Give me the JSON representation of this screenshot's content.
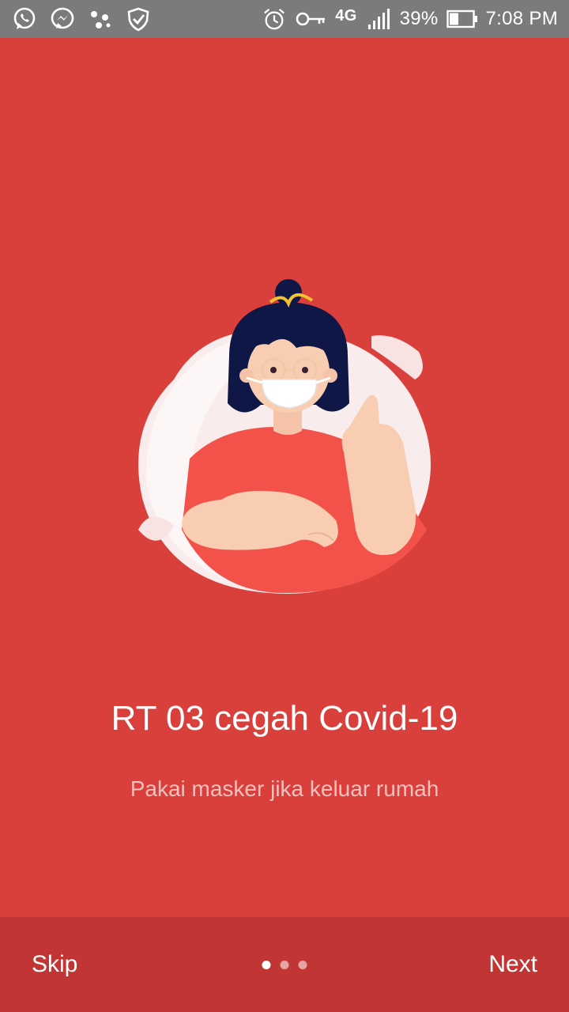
{
  "status_bar": {
    "left_icons": [
      "whatsapp-icon",
      "messenger-icon",
      "app-dots-icon",
      "shield-check-icon"
    ],
    "right_icons": [
      "alarm-icon",
      "key-icon",
      "signal-icon",
      "battery-icon"
    ],
    "network": "4G",
    "battery_percent": "39%",
    "battery_level": 0.39,
    "time": "7:08 PM"
  },
  "onboarding": {
    "illustration": "woman-wearing-mask-thumbs-up",
    "title": "RT 03 cegah Covid-19",
    "subtitle": "Pakai masker jika keluar rumah"
  },
  "bottom_bar": {
    "skip_label": "Skip",
    "next_label": "Next",
    "page_count": 3,
    "current_page": 1
  },
  "colors": {
    "background": "#D9403C",
    "bottom_bar": "#C13634",
    "status_bar": "#7B7B7B",
    "subtitle": "#F4C1BE"
  }
}
